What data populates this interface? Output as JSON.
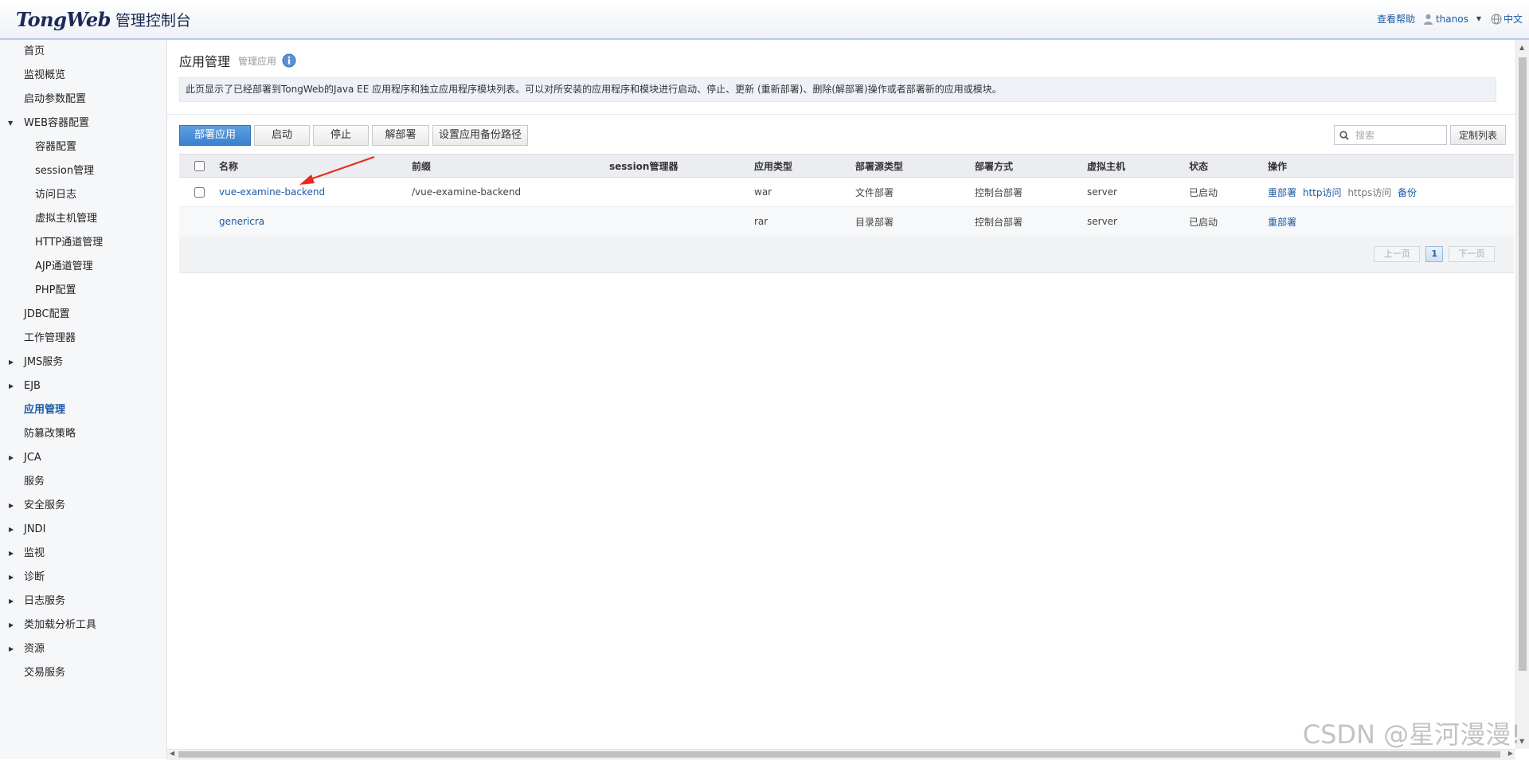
{
  "header": {
    "logo_brand": "TongWeb",
    "logo_sub": "管理控制台",
    "help": "查看帮助",
    "user": "thanos",
    "lang": "中文"
  },
  "sidebar": {
    "items": [
      {
        "label": "首页",
        "level": 0
      },
      {
        "label": "监视概览",
        "level": 0
      },
      {
        "label": "启动参数配置",
        "level": 0
      },
      {
        "label": "WEB容器配置",
        "level": 0,
        "expanded": true
      },
      {
        "label": "容器配置",
        "level": 1
      },
      {
        "label": "session管理",
        "level": 1
      },
      {
        "label": "访问日志",
        "level": 1
      },
      {
        "label": "虚拟主机管理",
        "level": 1
      },
      {
        "label": "HTTP通道管理",
        "level": 1
      },
      {
        "label": "AJP通道管理",
        "level": 1
      },
      {
        "label": "PHP配置",
        "level": 1
      },
      {
        "label": "JDBC配置",
        "level": 0
      },
      {
        "label": "工作管理器",
        "level": 0
      },
      {
        "label": "JMS服务",
        "level": 0,
        "collapsed": true
      },
      {
        "label": "EJB",
        "level": 0,
        "collapsed": true
      },
      {
        "label": "应用管理",
        "level": 0,
        "active": true
      },
      {
        "label": "防篡改策略",
        "level": 0
      },
      {
        "label": "JCA",
        "level": 0,
        "collapsed": true
      },
      {
        "label": "服务",
        "level": 0
      },
      {
        "label": "安全服务",
        "level": 0,
        "collapsed": true
      },
      {
        "label": "JNDI",
        "level": 0,
        "collapsed": true
      },
      {
        "label": "监视",
        "level": 0,
        "collapsed": true
      },
      {
        "label": "诊断",
        "level": 0,
        "collapsed": true
      },
      {
        "label": "日志服务",
        "level": 0,
        "collapsed": true
      },
      {
        "label": "类加载分析工具",
        "level": 0,
        "collapsed": true
      },
      {
        "label": "资源",
        "level": 0,
        "collapsed": true
      },
      {
        "label": "交易服务",
        "level": 0
      }
    ]
  },
  "main": {
    "title": "应用管理",
    "subtitle": "管理应用",
    "description": "此页显示了已经部署到TongWeb的Java EE 应用程序和独立应用程序模块列表。可以对所安装的应用程序和模块进行启动、停止、更新 (重新部署)、删除(解部署)操作或者部署新的应用或模块。",
    "toolbar": {
      "deploy": "部署应用",
      "start": "启动",
      "stop": "停止",
      "undeploy": "解部署",
      "backup_path": "设置应用备份路径"
    },
    "search": {
      "placeholder": "搜索"
    },
    "customize": "定制列表",
    "table": {
      "headers": [
        "名称",
        "前缀",
        "session管理器",
        "应用类型",
        "部署源类型",
        "部署方式",
        "虚拟主机",
        "状态",
        "操作"
      ],
      "rows": [
        {
          "name": "vue-examine-backend",
          "prefix": "/vue-examine-backend",
          "session": "",
          "type": "war",
          "source": "文件部署",
          "method": "控制台部署",
          "host": "server",
          "status": "已启动",
          "actions": {
            "redeploy": "重部署",
            "http": "http访问",
            "https": "https访问",
            "backup": "备份"
          }
        },
        {
          "name": "genericra",
          "prefix": "",
          "session": "",
          "type": "rar",
          "source": "目录部署",
          "method": "控制台部署",
          "host": "server",
          "status": "已启动",
          "actions": {
            "redeploy": "重部署"
          }
        }
      ]
    },
    "pager": {
      "prev": "上一页",
      "current": "1",
      "next": "下一页"
    }
  },
  "watermark": "CSDN @星河漫漫!",
  "colors": {
    "accent": "#1c5aa6",
    "primary_button": "#3a80cd",
    "annotation_arrow": "#e8291c"
  }
}
